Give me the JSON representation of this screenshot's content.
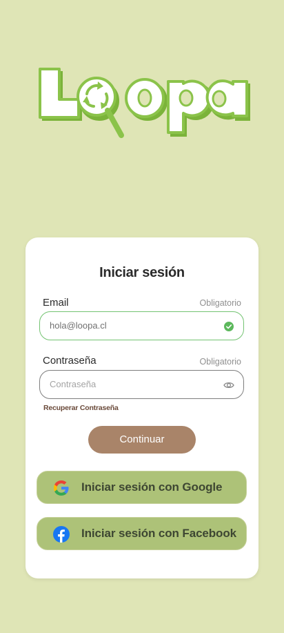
{
  "brand": {
    "logo_text": "Loopa"
  },
  "login": {
    "title": "Iniciar sesión",
    "email": {
      "label": "Email",
      "required": "Obligatorio",
      "value": "hola@loopa.cl"
    },
    "password": {
      "label": "Contraseña",
      "required": "Obligatorio",
      "placeholder": "Contraseña"
    },
    "recover_link": "Recuperar Contraseña",
    "continue_label": "Continuar",
    "google_label": "Iniciar sesión con Google",
    "facebook_label": "Iniciar sesión con Facebook"
  },
  "icons": {
    "email_status": "check-circle-icon",
    "password_toggle": "eye-icon",
    "google": "google-icon",
    "facebook": "facebook-icon"
  },
  "colors": {
    "background": "#dfe5b6",
    "brand_green": "#8bc34a",
    "continue_button": "#a98469",
    "social_button": "#adc278",
    "valid": "#5cb85c"
  }
}
